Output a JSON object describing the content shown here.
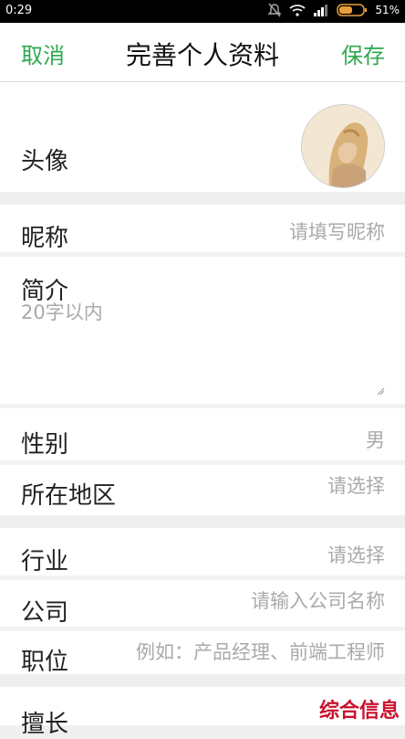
{
  "status_bar": {
    "time": "0:29",
    "battery": "51%"
  },
  "header": {
    "cancel": "取消",
    "title": "完善个人资料",
    "save": "保存"
  },
  "profile": {
    "avatar_label": "头像",
    "nickname_label": "昵称",
    "nickname_placeholder": "请填写昵称",
    "intro_label": "简介",
    "intro_placeholder": "20字以内",
    "gender_label": "性别",
    "gender_value": "男",
    "region_label": "所在地区",
    "region_placeholder": "请选择"
  },
  "work": {
    "industry_label": "行业",
    "industry_placeholder": "请选择",
    "company_label": "公司",
    "company_placeholder": "请输入公司名称",
    "position_label": "职位",
    "position_placeholder": "例如：产品经理、前端工程师",
    "specialty_label": "擅长"
  },
  "watermark": "综合信息",
  "colors": {
    "accent": "#2fa84f",
    "watermark": "#c8102e"
  }
}
